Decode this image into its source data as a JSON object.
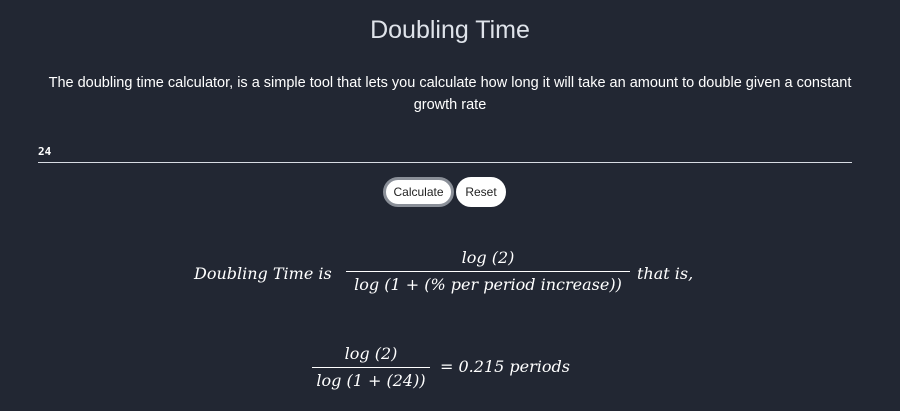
{
  "page": {
    "title": "Doubling Time",
    "description": "The doubling time calculator, is a simple tool that lets you calculate how long it will take an amount to double given a constant growth rate"
  },
  "form": {
    "rate_value": "24",
    "calculate_label": "Calculate",
    "reset_label": "Reset"
  },
  "formula": {
    "lead": "Doubling Time is",
    "numerator": "log (2)",
    "denominator": "log (1 + (% per period increase))",
    "tail": "that is,"
  },
  "result": {
    "numerator": "log (2)",
    "denominator": "log (1 + (24))",
    "equals_value": "= 0.215 periods"
  },
  "colors": {
    "background": "#222733",
    "text": "#ffffff",
    "button_bg": "#ffffff"
  }
}
